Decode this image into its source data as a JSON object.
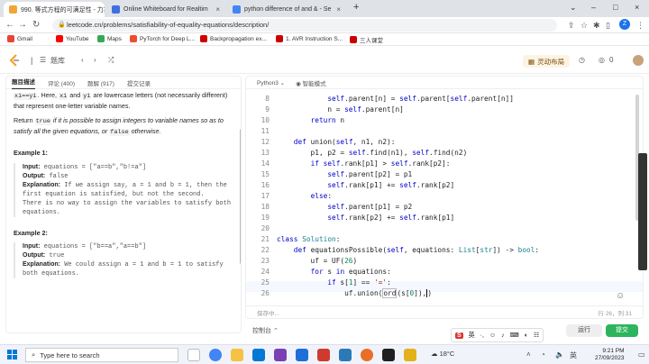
{
  "browser": {
    "tabs": [
      {
        "title": "990. 等式方程的可满足性 - 力扣",
        "favicon_color": "#f2a534"
      },
      {
        "title": "Online Whiteboard for Realtim",
        "favicon_color": "#3f6fe0"
      },
      {
        "title": "python difference of and & - Se",
        "favicon_color": "#4285f4"
      }
    ],
    "new_tab": "+",
    "url": "leetcode.cn/problems/satisfiability-of-equality-equations/description/",
    "profile_initial": "Z",
    "bookmarks": [
      {
        "label": "Gmail",
        "color": "#ea4335"
      },
      {
        "label": "YouTube",
        "color": "#ff0000"
      },
      {
        "label": "Maps",
        "color": "#34a853"
      },
      {
        "label": "PyTorch for Deep L...",
        "color": "#ee4c2c"
      },
      {
        "label": "Backpropagation ex...",
        "color": "#cc0000"
      },
      {
        "label": "1. AVR Instruction S...",
        "color": "#cc0000"
      },
      {
        "label": "三人课堂",
        "color": "#cc0000"
      }
    ]
  },
  "leetcode": {
    "nav_title": "题库",
    "premium_label": "灵动布局",
    "coin_count": "0",
    "left_tabs": [
      "题目描述",
      "评论 (400)",
      "题解 (917)",
      "提交记录"
    ],
    "desc_var": "xi==yi",
    "desc_l1": ". Here, ",
    "desc_x": "xi",
    "desc_and": " and ",
    "desc_y": "yi",
    "desc_l2": " are lowercase letters (not necessarily different) that represent one-letter variable names.",
    "return_pre": "Return ",
    "return_true": "true",
    "return_mid": " if it is possible to assign integers to variable names so as to satisfy all the given equations, or ",
    "return_false": "false",
    "return_post": " otherwise.",
    "example1": {
      "title": "Example 1:",
      "input_label": "Input:",
      "input": "equations = [\"a==b\",\"b!=a\"]",
      "output_label": "Output:",
      "output": "false",
      "expl_label": "Explanation:",
      "explanation": "If we assign say, a = 1 and b = 1, then the first equation is satisfied, but not the second.\nThere is no way to assign the variables to satisfy both equations."
    },
    "example2": {
      "title": "Example 2:",
      "input_label": "Input:",
      "input": "equations = [\"b==a\",\"a==b\"]",
      "output_label": "Output:",
      "output": "true",
      "expl_label": "Explanation:",
      "explanation": "We could assign a = 1 and b = 1 to satisfy both equations."
    },
    "editor": {
      "language": "Python3",
      "mode": "智能模式",
      "status_left": "保存中...",
      "status_pos": "行 26，列 31",
      "lines": [
        "8",
        "9",
        "10",
        "11",
        "12",
        "13",
        "14",
        "15",
        "16",
        "17",
        "18",
        "19",
        "20",
        "21",
        "22",
        "23",
        "24",
        "25",
        "26"
      ]
    },
    "console_label": "控制台",
    "run_label": "运行",
    "submit_label": "提交"
  },
  "taskbar": {
    "search_placeholder": "Type here to search",
    "weather": "18°C",
    "ime_label": "英",
    "time": "9:21 PM",
    "date": "27/09/2023"
  }
}
